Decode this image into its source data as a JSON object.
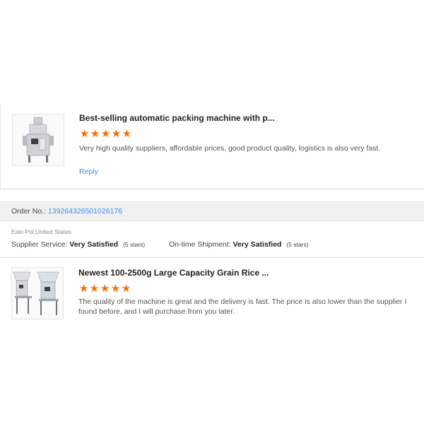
{
  "reviews": [
    {
      "product_title": "Best-selling automatic packing machine with p...",
      "rating_stars": 5,
      "comment": "Very high quality suppliers, affordable prices, good product quality, logistics is also very fast.",
      "reply_label": "Reply"
    },
    {
      "product_title": "Newest 100-2500g Large Capacity Grain Rice ...",
      "rating_stars": 5,
      "comment": "The quality of the machine is great and the delivery is fast. The price is also lower than the supplier I found before, and I will purchase from you later."
    }
  ],
  "order": {
    "label": "Order No.:",
    "number": "139264326501026176"
  },
  "buyer": {
    "location": "Ealo Pol,United States"
  },
  "ratings": {
    "supplier_service_label": "Supplier Service:",
    "supplier_service_value": "Very Satisfied",
    "supplier_service_count": "(5 stars)",
    "shipment_label": "On-time Shipment:",
    "shipment_value": "Very Satisfied",
    "shipment_count": "(5 stars)"
  },
  "colors": {
    "star": "#ff6a00",
    "link": "#3a8ee6"
  }
}
